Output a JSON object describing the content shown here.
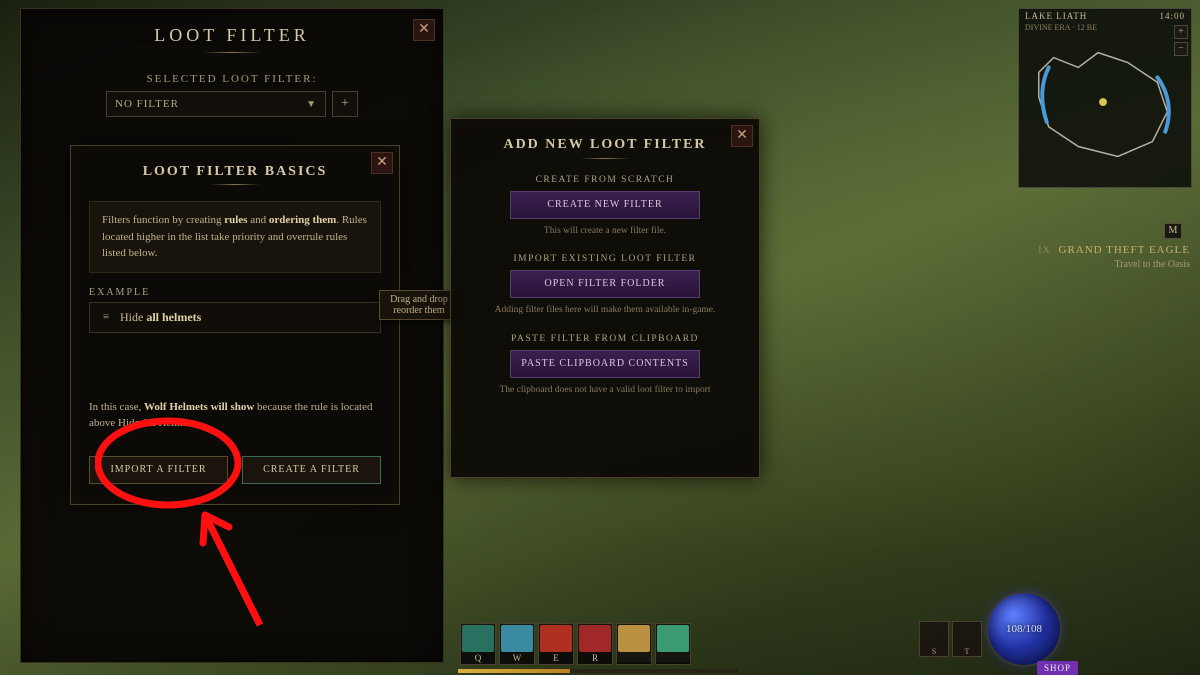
{
  "loot_filter": {
    "title": "LOOT FILTER",
    "selected_label": "SELECTED LOOT FILTER:",
    "selected_value": "NO FILTER"
  },
  "basics": {
    "title": "LOOT FILTER BASICS",
    "info_pre": "Filters function by creating ",
    "info_b1": "rules",
    "info_mid": " and ",
    "info_b2": "ordering them",
    "info_post": ". Rules located higher in the list take priority and overrule rules listed below.",
    "example_label": "EXAMPLE",
    "rule_hide": "Hide ",
    "rule_target": "all helmets",
    "tooltip": "Drag and drop reorder them",
    "case_pre": "In this case, ",
    "case_b1": "Wolf Helmets will show",
    "case_mid": " because the rule is located above Hide All Helmets",
    "import_btn": "IMPORT A FILTER",
    "create_btn": "CREATE A FILTER"
  },
  "add_modal": {
    "title": "ADD NEW LOOT FILTER",
    "scratch_label": "CREATE FROM SCRATCH",
    "create_btn": "CREATE NEW FILTER",
    "create_sub": "This will create a new filter file.",
    "import_label": "IMPORT EXISTING LOOT FILTER",
    "open_btn": "OPEN FILTER FOLDER",
    "open_sub": "Adding filter files here will make them available in-game.",
    "paste_label": "PASTE FILTER FROM CLIPBOARD",
    "paste_btn": "PASTE CLIPBOARD CONTENTS",
    "paste_sub": "The clipboard does not have a valid loot filter to import"
  },
  "minimap": {
    "zone": "LAKE LIATH",
    "era": "DIVINE ERA",
    "year": "12 BE",
    "time": "14:00"
  },
  "quest": {
    "prefix": "IX",
    "title": "GRAND THEFT EAGLE",
    "objective": "Travel to the Oasis"
  },
  "hud": {
    "skills": [
      "Q",
      "W",
      "E",
      "R",
      "",
      ""
    ],
    "skill_colors": [
      "#2a7060",
      "#3a8aa0",
      "#b03020",
      "#a02828",
      "#b89040",
      "#3a9a70"
    ],
    "hp": "108/108",
    "side_keys": [
      "S",
      "T"
    ],
    "shop": "SHOP",
    "m_key": "M"
  }
}
